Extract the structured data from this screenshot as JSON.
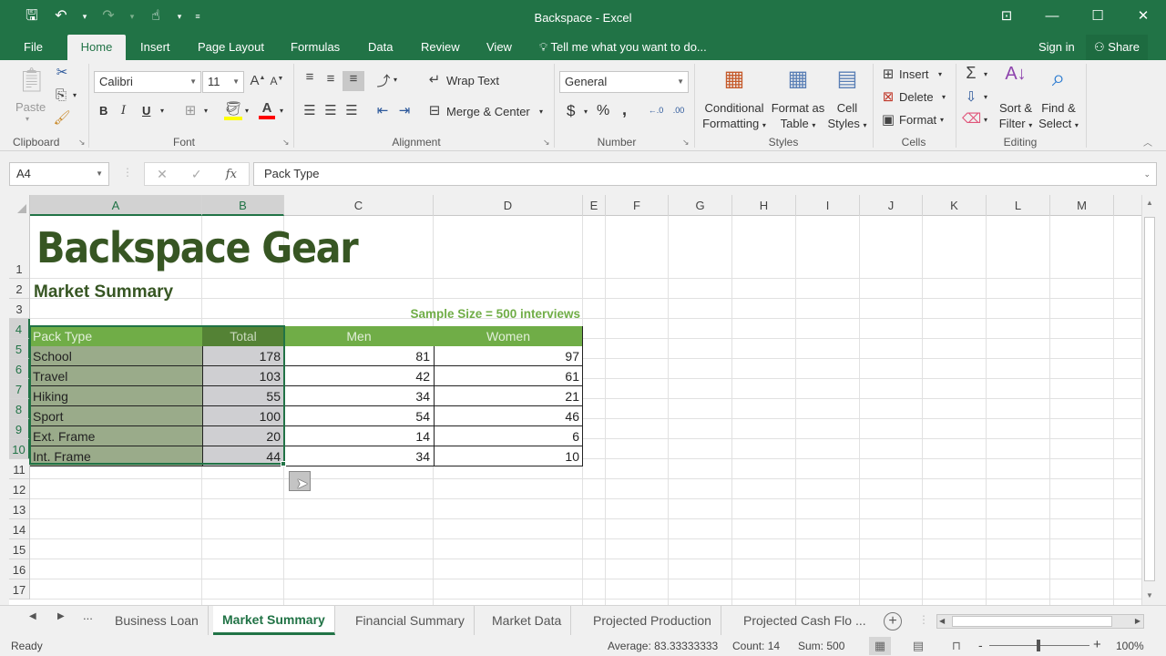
{
  "window": {
    "title": "Backspace - Excel",
    "controls": [
      "ribbon-display-options",
      "minimize",
      "maximize",
      "close"
    ]
  },
  "ribbon_tabs": [
    "File",
    "Home",
    "Insert",
    "Page Layout",
    "Formulas",
    "Data",
    "Review",
    "View"
  ],
  "active_tab": "Home",
  "tell_me": "Tell me what you want to do...",
  "sign_in": "Sign in",
  "share": "Share",
  "ribbon": {
    "clipboard": {
      "label": "Clipboard",
      "paste": "Paste"
    },
    "font": {
      "label": "Font",
      "name": "Calibri",
      "size": "11",
      "bold": "B",
      "italic": "I",
      "underline": "U",
      "fill_color": "#FFFF00",
      "font_color": "#FF0000"
    },
    "alignment": {
      "label": "Alignment",
      "wrap_text": "Wrap Text",
      "merge_center": "Merge & Center"
    },
    "number": {
      "label": "Number",
      "format": "General",
      "currency": "$",
      "percent": "%",
      "comma": ",",
      "inc_decimal": "←.0 .00",
      "dec_decimal": ".00 →.0"
    },
    "styles": {
      "label": "Styles",
      "conditional_1": "Conditional",
      "conditional_2": "Formatting",
      "format_table_1": "Format as",
      "format_table_2": "Table",
      "cell_styles_1": "Cell",
      "cell_styles_2": "Styles"
    },
    "cells": {
      "label": "Cells",
      "insert": "Insert",
      "delete": "Delete",
      "format": "Format"
    },
    "editing": {
      "label": "Editing",
      "sort_1": "Sort &",
      "sort_2": "Filter",
      "find_1": "Find &",
      "find_2": "Select"
    }
  },
  "formula_bar": {
    "name_box": "A4",
    "cancel": "✕",
    "enter": "✓",
    "fx": "fx",
    "content": "Pack Type"
  },
  "columns": [
    "A",
    "B",
    "C",
    "D",
    "E",
    "F",
    "G",
    "H",
    "I",
    "J",
    "K",
    "L",
    "M"
  ],
  "rows": [
    "1",
    "2",
    "3",
    "4",
    "5",
    "6",
    "7",
    "8",
    "9",
    "10",
    "11",
    "12",
    "13",
    "14",
    "15",
    "16",
    "17"
  ],
  "sheet": {
    "title": "Backspace Gear",
    "subtitle": "Market Summary",
    "sample_note": "Sample Size = 500 interviews",
    "headers": [
      "Pack Type",
      "Total",
      "Men",
      "Women"
    ],
    "table": [
      {
        "type": "School",
        "total": "178",
        "men": "81",
        "women": "97"
      },
      {
        "type": "Travel",
        "total": "103",
        "men": "42",
        "women": "61"
      },
      {
        "type": "Hiking",
        "total": "55",
        "men": "34",
        "women": "21"
      },
      {
        "type": "Sport",
        "total": "100",
        "men": "54",
        "women": "46"
      },
      {
        "type": "Ext. Frame",
        "total": "20",
        "men": "14",
        "women": "6"
      },
      {
        "type": "Int. Frame",
        "total": "44",
        "men": "34",
        "women": "10"
      }
    ],
    "selection": "A4:B10",
    "header_color": "#70AD47",
    "title_color": "#375623"
  },
  "sheet_tabs": [
    "Business Loan",
    "Market Summary",
    "Financial Summary",
    "Market Data",
    "Projected Production",
    "Projected Cash Flo ..."
  ],
  "active_sheet": "Market Summary",
  "sheet_nav_more": "...",
  "status": {
    "ready": "Ready",
    "average": "Average: 83.33333333",
    "count": "Count: 14",
    "sum": "Sum: 500",
    "zoom": "100%",
    "zoom_minus": "-",
    "zoom_plus": "+"
  }
}
